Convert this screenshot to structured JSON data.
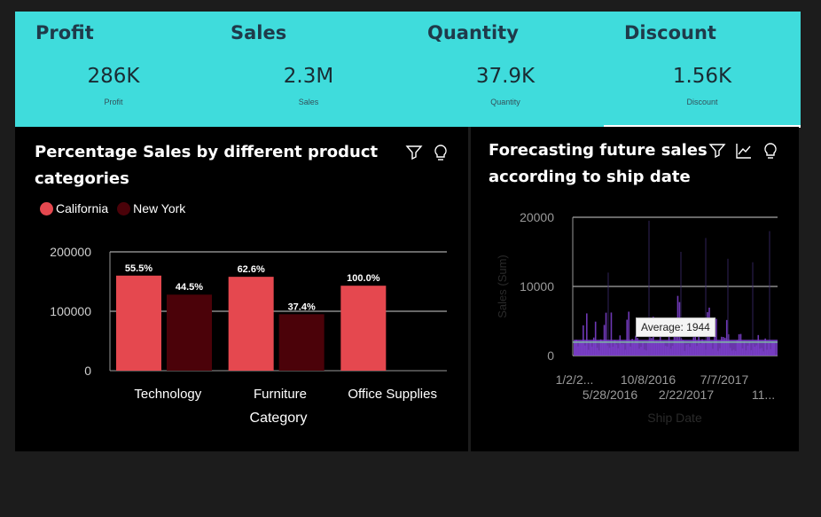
{
  "kpis": [
    {
      "title": "Profit",
      "value": "286K",
      "label": "Profit"
    },
    {
      "title": "Sales",
      "value": "2.3M",
      "label": "Sales"
    },
    {
      "title": "Quantity",
      "value": "37.9K",
      "label": "Quantity"
    },
    {
      "title": "Discount",
      "value": "1.56K",
      "label": "Discount"
    }
  ],
  "left_panel": {
    "title_line1": "Percentage Sales by different product",
    "title_line2": "categories",
    "icons": [
      "filter-icon",
      "lightbulb-icon"
    ]
  },
  "right_panel": {
    "title_line1": "Forecasting future sales",
    "title_line2": "according to ship date",
    "icons": [
      "filter-icon",
      "trend-icon",
      "lightbulb-icon"
    ],
    "tooltip": "Average: 1944"
  },
  "colors": {
    "kpi_band": "#3fdcdc",
    "california": "#e5484f",
    "new_york": "#4b0209",
    "forecast": "#7b3fc9"
  },
  "chart_data": [
    {
      "type": "bar",
      "categories": [
        "Technology",
        "Furniture",
        "Office Supplies"
      ],
      "series": [
        {
          "name": "California",
          "values": [
            160000,
            158000,
            143000
          ],
          "labels": [
            "55.5%",
            "62.6%",
            "100.0%"
          ]
        },
        {
          "name": "New York",
          "values": [
            128000,
            95000,
            null
          ],
          "labels": [
            "44.5%",
            "37.4%",
            ""
          ]
        }
      ],
      "xlabel": "Category",
      "ylabel": "",
      "yticks": [
        "0",
        "100000",
        "200000"
      ],
      "ylim": [
        0,
        200000
      ],
      "legend": "top-left",
      "grid": true
    },
    {
      "type": "area",
      "xlabel": "Ship Date",
      "ylabel": "Sales (Sum)",
      "yticks": [
        "0",
        "10000",
        "20000"
      ],
      "ylim": [
        0,
        20000
      ],
      "xticks_row1": [
        "1/2/2...",
        "10/8/2016",
        "7/7/2017"
      ],
      "xticks_row2": [
        "5/28/2016",
        "2/22/2017",
        "11..."
      ],
      "reference_line": {
        "label": "Average: 1944",
        "value": 1944
      },
      "forecast_start": "1/2/2016",
      "grid": true
    }
  ]
}
